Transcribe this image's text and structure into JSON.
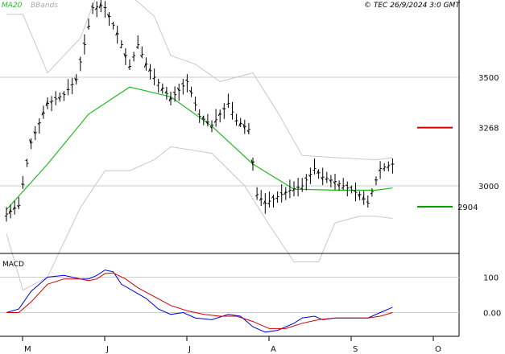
{
  "legend": {
    "ma_label": "MA20",
    "bb_label": "BBands"
  },
  "copyright": "© TEC 26/9/2024 3:0 GMT",
  "macd_label": "MACD",
  "levels": {
    "resistance": {
      "label": "3268",
      "value": 3268,
      "color": "#cc0000"
    },
    "support": {
      "label": "2904",
      "value": 2904,
      "color": "#009900"
    }
  },
  "colors": {
    "bars": "#000000",
    "ma": "#22bb22",
    "bands": "#c8c8c8",
    "macd": "#0000dd",
    "signal": "#cc0000",
    "grid": "#cccccc",
    "axis": "#000000"
  },
  "chart_data": [
    {
      "type": "ohlc",
      "ylim": [
        2700,
        3800
      ],
      "y_ticks": [
        {
          "value": 3500,
          "label": "3500"
        },
        {
          "value": 3000,
          "label": "3000"
        }
      ],
      "x_ticks": [
        "M",
        "J",
        "J",
        "A",
        "S",
        "O"
      ],
      "x_tick_positions": [
        0,
        1,
        2,
        3,
        4,
        5
      ],
      "xlim": [
        0,
        5.6
      ],
      "series": [
        {
          "name": "MA20",
          "kind": "line",
          "points": [
            [
              0,
              2890
            ],
            [
              0.5,
              3100
            ],
            [
              1,
              3330
            ],
            [
              1.5,
              3455
            ],
            [
              2,
              3410
            ],
            [
              2.5,
              3275
            ],
            [
              3,
              3100
            ],
            [
              3.5,
              2985
            ],
            [
              4,
              2980
            ],
            [
              4.5,
              2980
            ],
            [
              4.7,
              2990
            ]
          ]
        },
        {
          "name": "BBands upper",
          "kind": "band",
          "points": [
            [
              0,
              3790
            ],
            [
              0.2,
              3790
            ],
            [
              0.5,
              3520
            ],
            [
              0.9,
              3680
            ],
            [
              1.1,
              3880
            ],
            [
              1.5,
              3880
            ],
            [
              1.8,
              3780
            ],
            [
              2,
              3600
            ],
            [
              2.3,
              3560
            ],
            [
              2.6,
              3480
            ],
            [
              3,
              3520
            ],
            [
              3.3,
              3340
            ],
            [
              3.6,
              3140
            ],
            [
              4,
              3130
            ],
            [
              4.5,
              3120
            ],
            [
              4.7,
              3130
            ]
          ]
        },
        {
          "name": "BBands lower",
          "kind": "band",
          "points": [
            [
              0,
              2780
            ],
            [
              0.2,
              2520
            ],
            [
              0.5,
              2580
            ],
            [
              0.9,
              2900
            ],
            [
              1.2,
              3070
            ],
            [
              1.5,
              3070
            ],
            [
              1.8,
              3120
            ],
            [
              2,
              3180
            ],
            [
              2.5,
              3150
            ],
            [
              2.9,
              3000
            ],
            [
              3.2,
              2820
            ],
            [
              3.5,
              2650
            ],
            [
              3.8,
              2650
            ],
            [
              4,
              2830
            ],
            [
              4.3,
              2860
            ],
            [
              4.5,
              2860
            ],
            [
              4.7,
              2850
            ]
          ]
        }
      ],
      "price_path": [
        [
          0,
          2870
        ],
        [
          0.15,
          2910
        ],
        [
          0.3,
          3200
        ],
        [
          0.5,
          3380
        ],
        [
          0.7,
          3420
        ],
        [
          0.85,
          3490
        ],
        [
          0.95,
          3650
        ],
        [
          1.05,
          3820
        ],
        [
          1.15,
          3830
        ],
        [
          1.2,
          3820
        ],
        [
          1.35,
          3700
        ],
        [
          1.5,
          3550
        ],
        [
          1.6,
          3650
        ],
        [
          1.7,
          3560
        ],
        [
          1.8,
          3500
        ],
        [
          2,
          3400
        ],
        [
          2.2,
          3480
        ],
        [
          2.35,
          3320
        ],
        [
          2.5,
          3280
        ],
        [
          2.7,
          3380
        ],
        [
          2.8,
          3300
        ],
        [
          2.95,
          3260
        ],
        [
          3.05,
          2960
        ],
        [
          3.15,
          2920
        ],
        [
          3.3,
          2950
        ],
        [
          3.45,
          2980
        ],
        [
          3.6,
          3000
        ],
        [
          3.75,
          3080
        ],
        [
          3.85,
          3040
        ],
        [
          4,
          3020
        ],
        [
          4.1,
          3000
        ],
        [
          4.3,
          2960
        ],
        [
          4.4,
          2920
        ],
        [
          4.55,
          3080
        ],
        [
          4.7,
          3100
        ]
      ]
    },
    {
      "type": "line",
      "title": "MACD",
      "ylim": [
        -60,
        160
      ],
      "y_ticks": [
        {
          "value": 100,
          "label": "100"
        },
        {
          "value": 0,
          "label": "0.00"
        }
      ],
      "series": [
        {
          "name": "MACD",
          "color": "#0000dd",
          "points": [
            [
              0,
              0
            ],
            [
              0.15,
              10
            ],
            [
              0.3,
              60
            ],
            [
              0.5,
              100
            ],
            [
              0.7,
              105
            ],
            [
              0.9,
              95
            ],
            [
              1.0,
              95
            ],
            [
              1.1,
              105
            ],
            [
              1.2,
              120
            ],
            [
              1.3,
              115
            ],
            [
              1.4,
              80
            ],
            [
              1.55,
              60
            ],
            [
              1.7,
              40
            ],
            [
              1.85,
              10
            ],
            [
              2,
              -5
            ],
            [
              2.15,
              0
            ],
            [
              2.3,
              -15
            ],
            [
              2.5,
              -20
            ],
            [
              2.7,
              -5
            ],
            [
              2.85,
              -10
            ],
            [
              3,
              -40
            ],
            [
              3.15,
              -55
            ],
            [
              3.3,
              -50
            ],
            [
              3.5,
              -30
            ],
            [
              3.6,
              -15
            ],
            [
              3.75,
              -10
            ],
            [
              3.85,
              -20
            ],
            [
              4,
              -15
            ],
            [
              4.2,
              -15
            ],
            [
              4.4,
              -15
            ],
            [
              4.55,
              0
            ],
            [
              4.7,
              15
            ]
          ]
        },
        {
          "name": "Signal",
          "color": "#cc0000",
          "points": [
            [
              0,
              0
            ],
            [
              0.15,
              0
            ],
            [
              0.3,
              30
            ],
            [
              0.5,
              80
            ],
            [
              0.7,
              95
            ],
            [
              0.9,
              95
            ],
            [
              1.0,
              90
            ],
            [
              1.1,
              95
            ],
            [
              1.2,
              110
            ],
            [
              1.3,
              112
            ],
            [
              1.45,
              95
            ],
            [
              1.6,
              70
            ],
            [
              1.8,
              45
            ],
            [
              2,
              20
            ],
            [
              2.2,
              5
            ],
            [
              2.4,
              -5
            ],
            [
              2.6,
              -10
            ],
            [
              2.8,
              -10
            ],
            [
              3,
              -25
            ],
            [
              3.2,
              -45
            ],
            [
              3.4,
              -45
            ],
            [
              3.6,
              -30
            ],
            [
              3.8,
              -20
            ],
            [
              4,
              -15
            ],
            [
              4.2,
              -15
            ],
            [
              4.4,
              -15
            ],
            [
              4.55,
              -10
            ],
            [
              4.7,
              0
            ]
          ]
        }
      ]
    }
  ]
}
